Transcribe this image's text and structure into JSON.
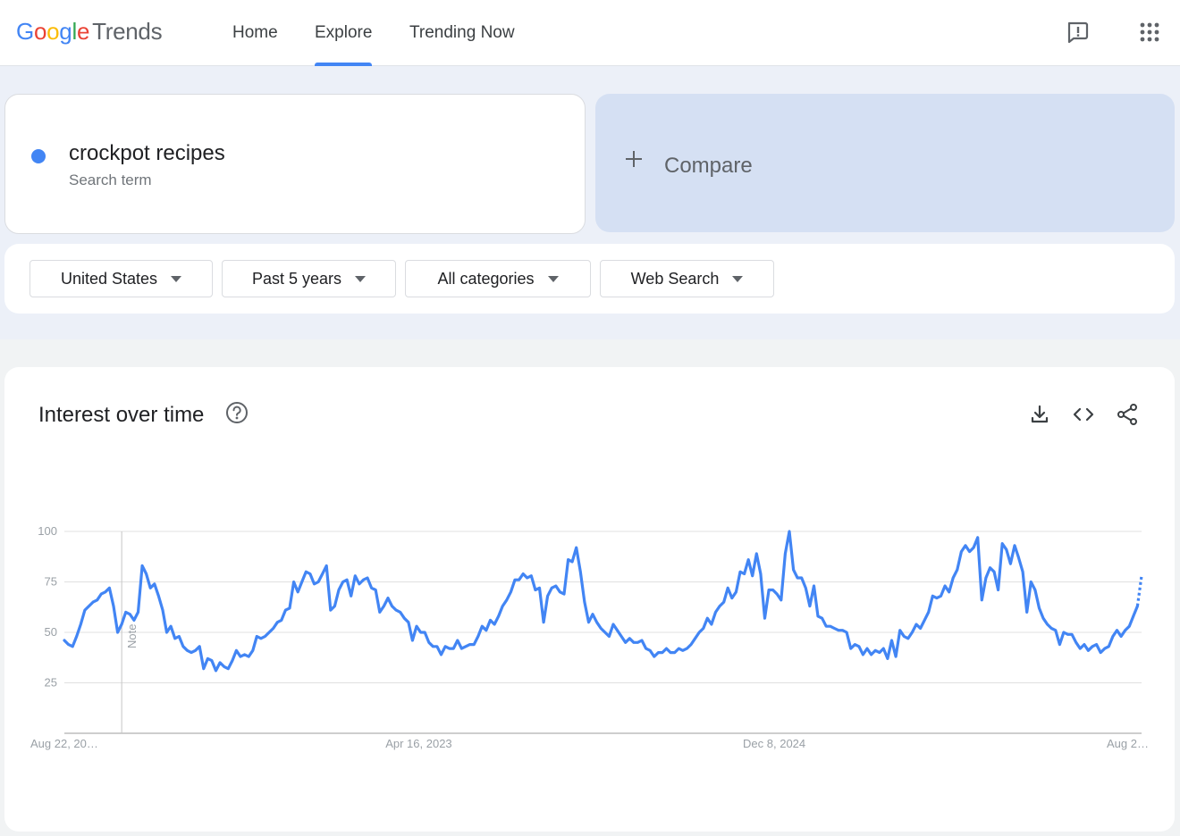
{
  "app": {
    "logo_google": [
      "G",
      "o",
      "o",
      "g",
      "l",
      "e"
    ],
    "logo_product": "Trends",
    "nav": [
      {
        "label": "Home",
        "active": false
      },
      {
        "label": "Explore",
        "active": true
      },
      {
        "label": "Trending Now",
        "active": false
      }
    ],
    "icons": {
      "feedback": "feedback-icon",
      "apps": "apps-grid-icon"
    }
  },
  "search": {
    "term": "crockpot recipes",
    "term_type": "Search term",
    "term_color": "#4285f4",
    "compare_label": "Compare"
  },
  "filters": [
    {
      "label": "United States"
    },
    {
      "label": "Past 5 years"
    },
    {
      "label": "All categories"
    },
    {
      "label": "Web Search"
    }
  ],
  "chart_card": {
    "title": "Interest over time",
    "tools": [
      "download-icon",
      "embed-code-icon",
      "share-icon"
    ],
    "note_label": "Note"
  },
  "chart_data": {
    "type": "line",
    "title": "Interest over time",
    "xlabel": "",
    "ylabel": "",
    "ylim": [
      0,
      100
    ],
    "yticks": [
      25,
      50,
      75,
      100
    ],
    "grid": true,
    "x_tick_labels": [
      "Aug 22, 20…",
      "Apr 16, 2023",
      "Dec 8, 2024",
      "Aug 2…"
    ],
    "note_marker_week": 14,
    "partial_last_point": true,
    "series": [
      {
        "color": "#4285f4",
        "values": [
          46,
          44,
          43,
          48,
          54,
          61,
          63,
          65,
          66,
          69,
          70,
          72,
          63,
          50,
          54,
          60,
          59,
          56,
          60,
          83,
          79,
          72,
          74,
          68,
          61,
          50,
          53,
          47,
          48,
          43,
          41,
          40,
          41,
          43,
          32,
          37,
          36,
          31,
          35,
          33,
          32,
          36,
          41,
          38,
          39,
          38,
          41,
          48,
          47,
          48,
          50,
          52,
          55,
          56,
          61,
          62,
          75,
          70,
          75,
          80,
          79,
          74,
          75,
          79,
          83,
          61,
          63,
          71,
          75,
          76,
          68,
          78,
          74,
          76,
          77,
          72,
          71,
          60,
          63,
          67,
          63,
          61,
          60,
          57,
          55,
          46,
          53,
          50,
          50,
          45,
          43,
          43,
          39,
          43,
          42,
          42,
          46,
          42,
          43,
          44,
          44,
          48,
          53,
          51,
          56,
          54,
          58,
          63,
          66,
          70,
          76,
          76,
          79,
          77,
          78,
          71,
          72,
          55,
          68,
          72,
          73,
          70,
          69,
          86,
          85,
          92,
          80,
          65,
          55,
          59,
          55,
          52,
          50,
          48,
          54,
          51,
          48,
          45,
          47,
          45,
          45,
          46,
          42,
          41,
          38,
          40,
          40,
          42,
          40,
          40,
          42,
          41,
          42,
          44,
          47,
          50,
          52,
          57,
          54,
          60,
          63,
          65,
          72,
          67,
          70,
          80,
          79,
          86,
          78,
          89,
          79,
          57,
          71,
          71,
          69,
          66,
          89,
          100,
          81,
          77,
          77,
          72,
          63,
          73,
          58,
          57,
          53,
          53,
          52,
          51,
          51,
          50,
          42,
          44,
          43,
          39,
          42,
          39,
          41,
          40,
          42,
          37,
          46,
          38,
          51,
          48,
          47,
          50,
          54,
          52,
          56,
          60,
          68,
          67,
          68,
          73,
          70,
          77,
          81,
          90,
          93,
          90,
          92,
          97,
          66,
          77,
          82,
          80,
          71,
          94,
          91,
          84,
          93,
          87,
          80,
          60,
          75,
          71,
          62,
          57,
          54,
          52,
          51,
          44,
          50,
          49,
          49,
          45,
          42,
          44,
          41,
          43,
          44,
          40,
          42,
          43,
          48,
          51,
          48,
          51,
          53,
          58,
          63,
          78
        ]
      }
    ]
  }
}
